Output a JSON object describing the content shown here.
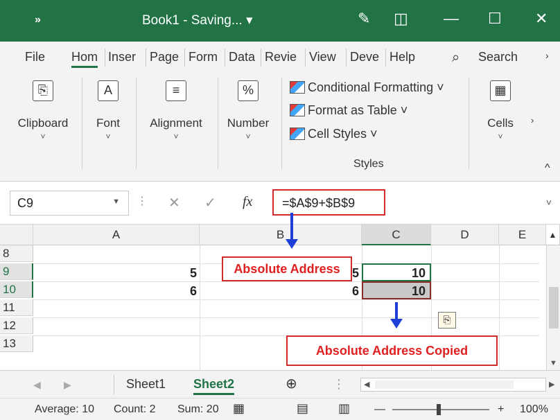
{
  "titlebar": {
    "chevrons": "»",
    "title": "Book1 - Saving... ▾"
  },
  "tabs": [
    "File",
    "Hom",
    "Inser",
    "Page",
    "Form",
    "Data",
    "Revie",
    "View",
    "Deve",
    "Help"
  ],
  "search_label": "Search",
  "ribbon": {
    "clipboard": "Clipboard",
    "font": "Font",
    "alignment": "Alignment",
    "number": "Number",
    "conditional_formatting": "Conditional Formatting ˅",
    "format_as_table": "Format as Table ˅",
    "cell_styles": "Cell Styles ˅",
    "styles_group": "Styles",
    "cells": "Cells"
  },
  "formula_bar": {
    "name_box": "C9",
    "fx": "fx",
    "formula": "=$A$9+$B$9"
  },
  "columns": [
    "A",
    "B",
    "C",
    "D",
    "E"
  ],
  "rows": [
    "8",
    "9",
    "10",
    "11",
    "12",
    "13"
  ],
  "cells": {
    "A9": "5",
    "A10": "6",
    "B9": "5",
    "B10": "6",
    "C9": "10",
    "C10": "10"
  },
  "callouts": {
    "absolute_address": "Absolute Address",
    "absolute_address_copied": "Absolute Address Copied"
  },
  "sheets": [
    "Sheet1",
    "Sheet2"
  ],
  "status": {
    "average": "Average: 10",
    "count": "Count: 2",
    "sum": "Sum: 20",
    "zoom": "100%"
  },
  "colors": {
    "accent": "#217346",
    "callout_red": "#d12a2a",
    "arrow_blue": "#1e3fd8"
  }
}
